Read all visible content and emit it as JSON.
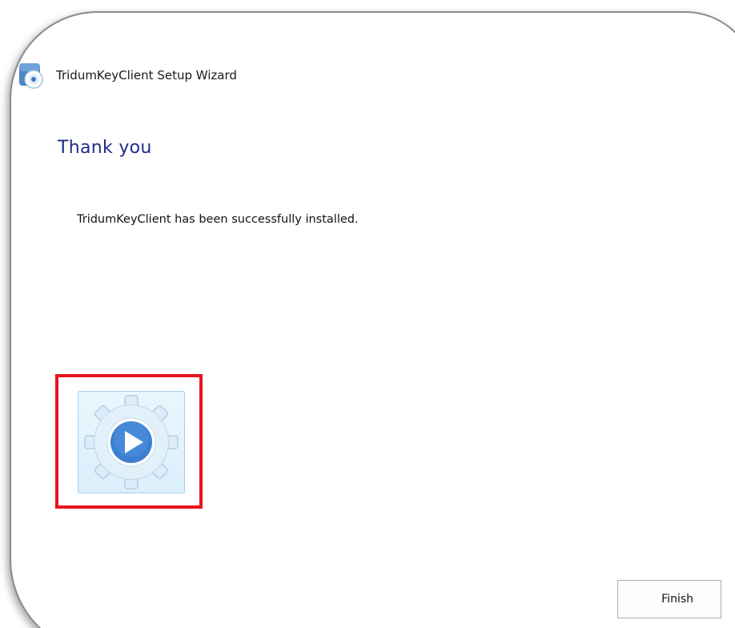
{
  "window": {
    "title": "TridumKeyClient Setup Wizard",
    "app_icon": "installer-disc-icon"
  },
  "content": {
    "heading": "Thank you",
    "message": "TridumKeyClient has been successfully installed.",
    "launch_icon": "gear-play-icon"
  },
  "buttons": {
    "finish_label": "Finish"
  },
  "colors": {
    "heading": "#1f2d8a",
    "highlight": "#e8141c",
    "play_blue": "#2f73c9",
    "gear_fill": "#d9ecf9"
  }
}
